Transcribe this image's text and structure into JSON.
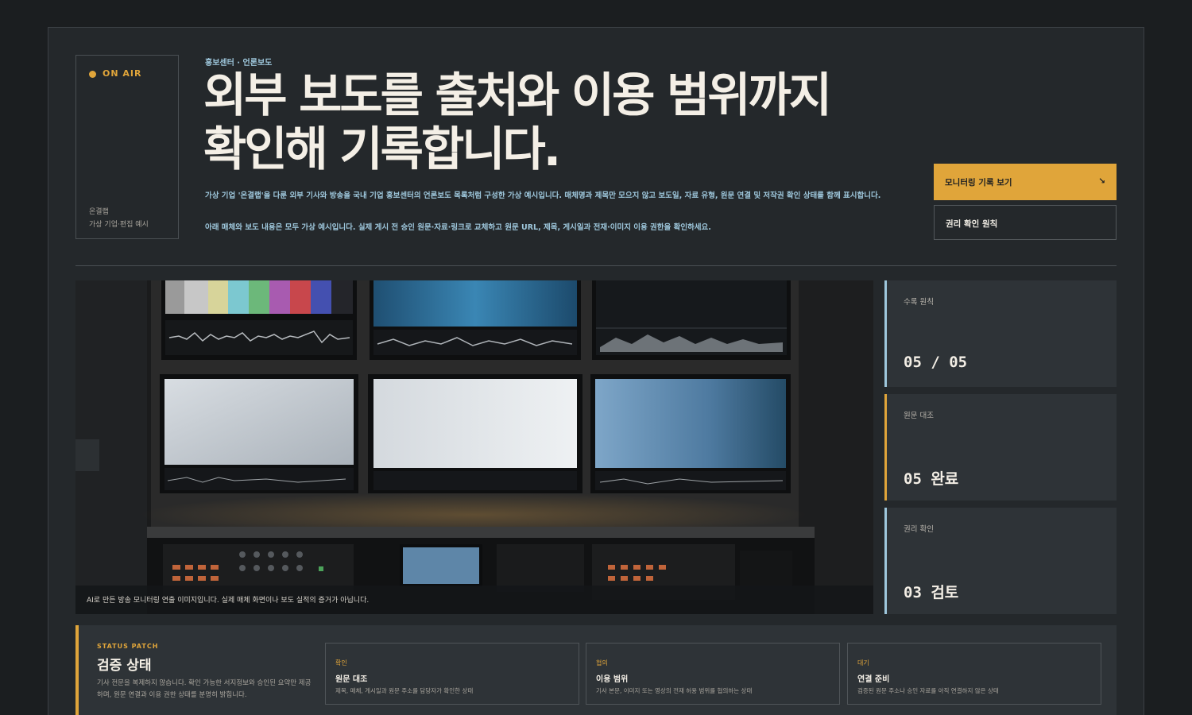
{
  "header": {
    "onair_label": "ON AIR",
    "brand_name": "온결랩",
    "brand_sub": "가상 기업·편집 예시",
    "kicker": "홍보센터 · 언론보도",
    "headline_line1": "외부 보도를 출처와 이용 범위까지",
    "headline_line2": "확인해 기록합니다.",
    "description": "가상 기업 '온결랩'을 다룬 외부 기사와 방송을 국내 기업 홍보센터의 언론보도 목록처럼 구성한 가상 예시입니다. 매체명과 제목만 모으지 않고 보도일, 자료 유형, 원문 연결 및 저작권 확인 상태를 함께 표시합니다.",
    "description2": "아래 매체와 보도 내용은 모두 가상 예시입니다. 실제 게시 전 승인 원문·자료·링크로 교체하고 원문 URL, 제목, 게시일과 전재·이미지 이용 권한을 확인하세요."
  },
  "actions": {
    "primary_label": "모니터링 기록 보기",
    "primary_icon": "arrow-down-right-icon",
    "secondary_label": "권리 확인 원칙"
  },
  "media": {
    "caption": "AI로 만든 방송 모니터링 연출 이미지입니다. 실제 매체 화면이나 보도 실적의 증거가 아닙니다."
  },
  "stats": [
    {
      "label": "수록 원칙",
      "value": "05 / 05"
    },
    {
      "label": "원문 대조",
      "value": "05 완료"
    },
    {
      "label": "권리 확인",
      "value": "03 검토"
    }
  ],
  "status_patch": {
    "tag": "STATUS PATCH",
    "title": "검증 상태",
    "note": "기사 전문을 복제하지 않습니다. 확인 가능한 서지정보와 승인된 요약만 제공하며, 원문 연결과 이용 권한 상태를 분명히 밝힙니다.",
    "cards": [
      {
        "kind": "확인",
        "title": "원문 대조",
        "desc": "제목, 매체, 게시일과 원문 주소를 담당자가 확인한 상태"
      },
      {
        "kind": "협의",
        "title": "이용 범위",
        "desc": "기사 본문, 이미지 또는 영상의 전재 허용 범위를 협의하는 상태"
      },
      {
        "kind": "대기",
        "title": "연결 준비",
        "desc": "검증된 원문 주소나 승인 자료를 아직 연결하지 않은 상태"
      }
    ]
  },
  "colors": {
    "accent": "#e0a53a",
    "info": "#9ec7dc",
    "panel": "#2e3337",
    "bg": "#24282b"
  }
}
